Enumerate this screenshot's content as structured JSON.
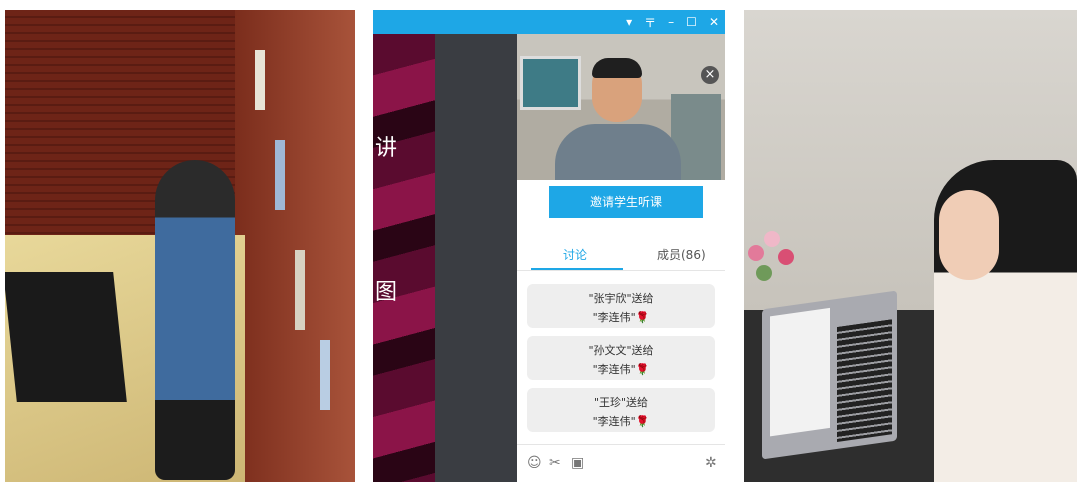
{
  "window": {
    "controls": [
      "▾",
      "〒",
      "–",
      "☐",
      "✕"
    ]
  },
  "slide": {
    "text_1": "讲",
    "text_2": "图"
  },
  "video": {
    "close": "×"
  },
  "chat": {
    "invite_label": "邀请学生听课",
    "tabs": [
      {
        "label": "讨论"
      },
      {
        "label": "成员(86)"
      }
    ],
    "messages": [
      {
        "line1": "\"张宇欣\"送给",
        "line2": "\"李连伟\"",
        "gift": "🌹"
      },
      {
        "line1": "\"孙文文\"送给",
        "line2": "\"李连伟\"",
        "gift": "🌹"
      },
      {
        "line1": "\"王珍\"送给",
        "line2": "\"李连伟\"",
        "gift": "🌹"
      }
    ],
    "toolbar_icons": [
      "☺",
      "✂",
      "▣",
      "✲"
    ]
  },
  "colors": {
    "accent": "#1ea7e6",
    "dark_panel": "#3a3d42"
  }
}
